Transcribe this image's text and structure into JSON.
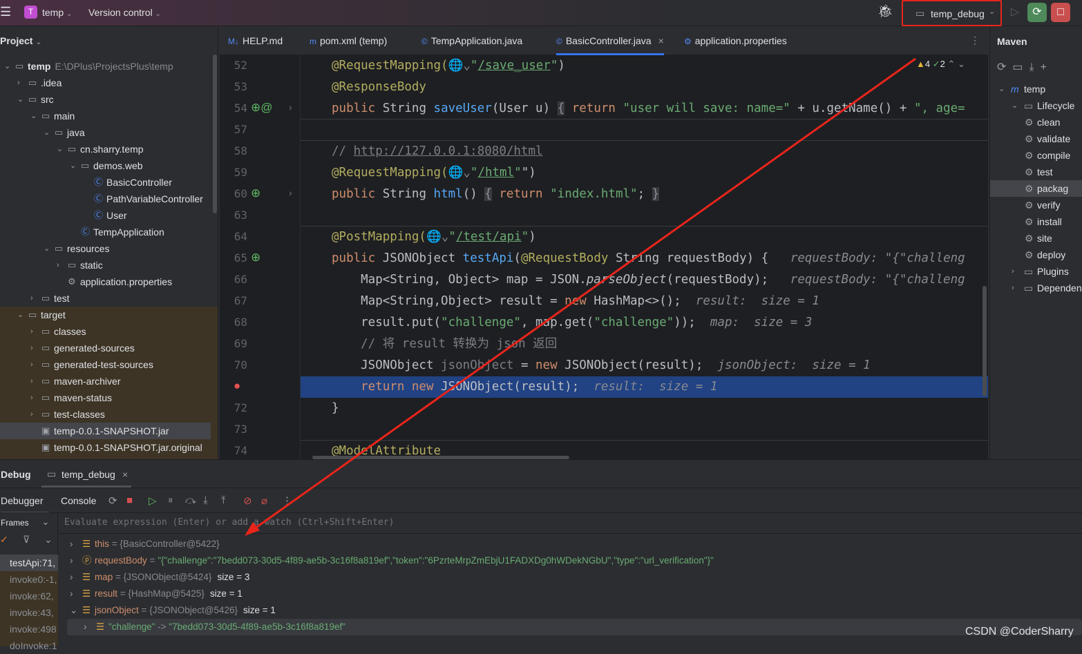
{
  "titlebar": {
    "project": "temp",
    "project_badge": "T",
    "vcs": "Version control",
    "run_config": "temp_debug"
  },
  "project_panel": {
    "title": "Project",
    "tree": [
      {
        "depth": 0,
        "open": true,
        "icon": "module-folder",
        "label": "temp",
        "hint": "E:\\DPlus\\ProjectsPlus\\temp",
        "bold": true
      },
      {
        "depth": 1,
        "open": false,
        "icon": "folder",
        "label": ".idea"
      },
      {
        "depth": 1,
        "open": true,
        "icon": "folder",
        "label": "src"
      },
      {
        "depth": 2,
        "open": true,
        "icon": "folder",
        "label": "main"
      },
      {
        "depth": 3,
        "open": true,
        "icon": "source-folder",
        "label": "java"
      },
      {
        "depth": 4,
        "open": true,
        "icon": "package",
        "label": "cn.sharry.temp"
      },
      {
        "depth": 5,
        "open": true,
        "icon": "package",
        "label": "demos.web"
      },
      {
        "depth": 6,
        "icon": "class",
        "label": "BasicController"
      },
      {
        "depth": 6,
        "icon": "class",
        "label": "PathVariableController"
      },
      {
        "depth": 6,
        "icon": "class",
        "label": "User"
      },
      {
        "depth": 5,
        "icon": "spring-class",
        "label": "TempApplication"
      },
      {
        "depth": 3,
        "open": true,
        "icon": "resources-folder",
        "label": "resources"
      },
      {
        "depth": 4,
        "open": false,
        "icon": "folder",
        "label": "static"
      },
      {
        "depth": 4,
        "icon": "properties",
        "label": "application.properties"
      },
      {
        "depth": 2,
        "open": false,
        "icon": "folder",
        "label": "test"
      },
      {
        "depth": 1,
        "open": true,
        "icon": "folder",
        "label": "target",
        "excluded": true
      },
      {
        "depth": 2,
        "open": false,
        "icon": "folder",
        "label": "classes",
        "excluded": true
      },
      {
        "depth": 2,
        "open": false,
        "icon": "folder",
        "label": "generated-sources",
        "excluded": true
      },
      {
        "depth": 2,
        "open": false,
        "icon": "folder",
        "label": "generated-test-sources",
        "excluded": true
      },
      {
        "depth": 2,
        "open": false,
        "icon": "folder",
        "label": "maven-archiver",
        "excluded": true
      },
      {
        "depth": 2,
        "open": false,
        "icon": "folder",
        "label": "maven-status",
        "excluded": true
      },
      {
        "depth": 2,
        "open": false,
        "icon": "folder",
        "label": "test-classes",
        "excluded": true
      },
      {
        "depth": 2,
        "icon": "jar",
        "label": "temp-0.0.1-SNAPSHOT.jar",
        "excluded": true,
        "selected": true
      },
      {
        "depth": 2,
        "icon": "file",
        "label": "temp-0.0.1-SNAPSHOT.jar.original",
        "excluded": true
      }
    ]
  },
  "editor": {
    "tabs": [
      {
        "icon": "M↓",
        "label": "HELP.md"
      },
      {
        "icon": "m",
        "label": "pom.xml (temp)"
      },
      {
        "icon": "©",
        "label": "TempApplication.java"
      },
      {
        "icon": "©",
        "label": "BasicController.java",
        "active": true,
        "closable": true
      },
      {
        "icon": "⚙",
        "label": "application.properties"
      }
    ],
    "inspections": {
      "warnings": "4",
      "ok": "2"
    },
    "lines": [
      {
        "num": "52",
        "tokens": [
          [
            "a",
            "@RequestMapping("
          ],
          [
            "g",
            "🌐⌄"
          ],
          [
            "s",
            "\""
          ],
          [
            "u",
            "/save_user"
          ],
          [
            "s",
            "\""
          ],
          [
            "",
            ")"
          ]
        ]
      },
      {
        "num": "53",
        "tokens": [
          [
            "a",
            "@ResponseBody"
          ]
        ]
      },
      {
        "num": "54",
        "gutter": "web-at",
        "fold": true,
        "tokens": [
          [
            "k",
            "public "
          ],
          [
            "",
            "String "
          ],
          [
            "f",
            "saveUser"
          ],
          [
            "",
            "(User u) "
          ],
          [
            "fold",
            "{"
          ],
          [
            "k",
            " return "
          ],
          [
            "s",
            "\"user will save: name=\""
          ],
          [
            "",
            " + u.getName() + "
          ],
          [
            "s",
            "\", age="
          ]
        ]
      },
      {
        "num": "57",
        "tokens": [],
        "sep_before": true
      },
      {
        "num": "58",
        "tokens": [
          [
            "c",
            "// "
          ],
          [
            "cu",
            "http://127.0.0.1:8080/html"
          ]
        ],
        "sep_before": true
      },
      {
        "num": "59",
        "tokens": [
          [
            "a",
            "@RequestMapping("
          ],
          [
            "g",
            "🌐⌄"
          ],
          [
            "s",
            "\""
          ],
          [
            "u",
            "/html"
          ],
          [
            "s",
            "\""
          ],
          [
            "",
            "\")"
          ]
        ]
      },
      {
        "num": "60",
        "gutter": "web",
        "fold": true,
        "tokens": [
          [
            "k",
            "public "
          ],
          [
            "",
            "String "
          ],
          [
            "f",
            "html"
          ],
          [
            "",
            "() "
          ],
          [
            "fold",
            "{"
          ],
          [
            "k",
            " return "
          ],
          [
            "s",
            "\"index.html\""
          ],
          [
            "",
            "; "
          ],
          [
            "fold",
            "}"
          ]
        ]
      },
      {
        "num": "63",
        "tokens": []
      },
      {
        "num": "64",
        "tokens": [
          [
            "a",
            "@PostMapping("
          ],
          [
            "g",
            "🌐⌄"
          ],
          [
            "s",
            "\""
          ],
          [
            "u",
            "/test/api"
          ],
          [
            "s",
            "\""
          ],
          [
            "",
            ")"
          ]
        ],
        "sep_before": true
      },
      {
        "num": "65",
        "gutter": "web",
        "tokens": [
          [
            "k",
            "public "
          ],
          [
            "",
            "JSONObject "
          ],
          [
            "f",
            "testApi"
          ],
          [
            "",
            "("
          ],
          [
            "a",
            "@RequestBody "
          ],
          [
            "",
            "String requestBody) {  "
          ],
          [
            "h",
            " requestBody: \"{\"challeng"
          ]
        ]
      },
      {
        "num": "66",
        "tokens": [
          [
            "",
            "    Map<String, Object> map = JSON."
          ],
          [
            "i",
            "parseObject"
          ],
          [
            "",
            "(requestBody);  "
          ],
          [
            "h",
            " requestBody: \"{\"challeng"
          ]
        ]
      },
      {
        "num": "67",
        "tokens": [
          [
            "",
            "    Map<String,Object> result = "
          ],
          [
            "k",
            "new "
          ],
          [
            "",
            "HashMap<>();  "
          ],
          [
            "h",
            "result:  size = 1"
          ]
        ]
      },
      {
        "num": "68",
        "tokens": [
          [
            "",
            "    result.put("
          ],
          [
            "s",
            "\"challenge\""
          ],
          [
            "",
            ", map.get("
          ],
          [
            "s",
            "\"challenge\""
          ],
          [
            "",
            "));  "
          ],
          [
            "h",
            "map:  size = 3"
          ]
        ]
      },
      {
        "num": "69",
        "tokens": [
          [
            "c",
            "    // 将 result 转换为 json 返回"
          ]
        ]
      },
      {
        "num": "70",
        "tokens": [
          [
            "",
            "    JSONObject "
          ],
          [
            "c",
            "jsonObject"
          ],
          [
            "",
            " = "
          ],
          [
            "k",
            "new "
          ],
          [
            "",
            "JSONObject(result);  "
          ],
          [
            "h",
            "jsonObject:  size = 1"
          ]
        ]
      },
      {
        "num": "",
        "gutter": "breakpoint",
        "exec": true,
        "tokens": [
          [
            "k",
            "    return new "
          ],
          [
            "",
            "JSONObject(result);  "
          ],
          [
            "h",
            "result:  size = 1"
          ]
        ]
      },
      {
        "num": "72",
        "tokens": [
          [
            "",
            "}"
          ]
        ]
      },
      {
        "num": "73",
        "tokens": []
      },
      {
        "num": "74",
        "tokens": [
          [
            "a",
            "@ModelAttribute"
          ]
        ],
        "sep_before": true
      }
    ]
  },
  "maven": {
    "title": "Maven",
    "tree": [
      {
        "depth": 0,
        "open": true,
        "icon": "m",
        "label": "temp"
      },
      {
        "depth": 1,
        "open": true,
        "icon": "folder",
        "label": "Lifecycle"
      },
      {
        "depth": 2,
        "icon": "gear",
        "label": "clean"
      },
      {
        "depth": 2,
        "icon": "gear",
        "label": "validate"
      },
      {
        "depth": 2,
        "icon": "gear",
        "label": "compile"
      },
      {
        "depth": 2,
        "icon": "gear",
        "label": "test"
      },
      {
        "depth": 2,
        "icon": "gear",
        "label": "packag",
        "selected": true
      },
      {
        "depth": 2,
        "icon": "gear",
        "label": "verify"
      },
      {
        "depth": 2,
        "icon": "gear",
        "label": "install"
      },
      {
        "depth": 2,
        "icon": "gear",
        "label": "site"
      },
      {
        "depth": 2,
        "icon": "gear",
        "label": "deploy"
      },
      {
        "depth": 1,
        "open": false,
        "icon": "folder",
        "label": "Plugins"
      },
      {
        "depth": 1,
        "open": false,
        "icon": "folder",
        "label": "Dependen"
      }
    ]
  },
  "debug": {
    "title": "Debug",
    "session": "temp_debug",
    "tabs": [
      "Debugger",
      "Console"
    ],
    "frames_label": "Frames",
    "eval_placeholder": "Evaluate expression (Enter) or add a watch (Ctrl+Shift+Enter)",
    "frames": [
      "testApi:71,",
      "invoke0:-1,",
      "invoke:62,",
      "invoke:43,",
      "invoke:498",
      "doInvoke:1"
    ],
    "variables": [
      {
        "name": "this",
        "value": "{BasicController@5422}",
        "size": "",
        "kind": "ref",
        "open": false
      },
      {
        "name": "requestBody",
        "value": "\"{\"challenge\":\"7bedd073-30d5-4f89-ae5b-3c16f8a819ef\",\"token\":\"6PzrteMrpZmEbjU1FADXDg0hWDekNGbU\",\"type\":\"url_verification\"}\"",
        "size": "",
        "kind": "param",
        "open": false
      },
      {
        "name": "map",
        "value": "{JSONObject@5424}",
        "size": "size = 3",
        "kind": "ref",
        "open": false
      },
      {
        "name": "result",
        "value": "{HashMap@5425}",
        "size": "size = 1",
        "kind": "ref",
        "open": false
      },
      {
        "name": "jsonObject",
        "value": "{JSONObject@5426}",
        "size": "size = 1",
        "kind": "ref",
        "open": true
      },
      {
        "name": "\"challenge\"",
        "value": "\"7bedd073-30d5-4f89-ae5b-3c16f8a819ef\"",
        "size": "",
        "kind": "entry",
        "open": false,
        "child": true
      }
    ]
  },
  "watermark": "CSDN @CoderSharry",
  "colors": {
    "accent": "#3574f0",
    "annotation_red": "#e8251b",
    "exec_line": "#214283",
    "excluded_bg": "#3d3425"
  }
}
